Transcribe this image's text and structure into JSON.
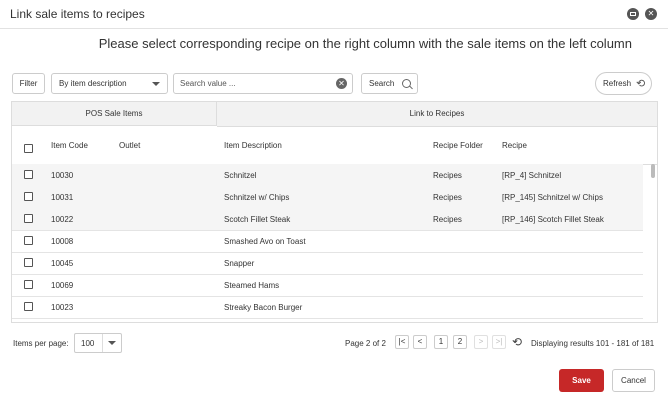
{
  "dialog": {
    "title": "Link sale items to recipes",
    "instructions": "Please select corresponding recipe on the right column with the sale items on the left column"
  },
  "toolbar": {
    "filter_label": "Filter",
    "filter_by": "By item description",
    "search_placeholder": "Search value ...",
    "search_label": "Search",
    "refresh_label": "Refresh"
  },
  "grid": {
    "group_headers": [
      "POS Sale Items",
      "Link to Recipes"
    ],
    "columns": [
      "Item Code",
      "Outlet",
      "Item Description",
      "Recipe Folder",
      "Recipe"
    ],
    "rows": [
      {
        "code": "10030",
        "outlet": "",
        "description": "Schnitzel",
        "folder": "Recipes",
        "recipe": "[RP_4] Schnitzel"
      },
      {
        "code": "10031",
        "outlet": "",
        "description": "Schnitzel w/ Chips",
        "folder": "Recipes",
        "recipe": "[RP_145] Schnitzel w/ Chips"
      },
      {
        "code": "10022",
        "outlet": "",
        "description": "Scotch Fillet Steak",
        "folder": "Recipes",
        "recipe": "[RP_146] Scotch Fillet Steak"
      },
      {
        "code": "10008",
        "outlet": "",
        "description": "Smashed Avo on Toast",
        "folder": "",
        "recipe": ""
      },
      {
        "code": "10045",
        "outlet": "",
        "description": "Snapper",
        "folder": "",
        "recipe": ""
      },
      {
        "code": "10069",
        "outlet": "",
        "description": "Steamed Hams",
        "folder": "",
        "recipe": ""
      },
      {
        "code": "10023",
        "outlet": "",
        "description": "Streaky Bacon Burger",
        "folder": "",
        "recipe": ""
      }
    ]
  },
  "pager": {
    "items_per_page_label": "Items per page:",
    "items_per_page": "100",
    "page_label": "Page 2 of 2",
    "first": "|<",
    "prev": "<",
    "pages": [
      "1",
      "2"
    ],
    "next": ">",
    "last": ">|",
    "display": "Displaying results 101 - 181 of 181"
  },
  "footer": {
    "save_label": "Save",
    "cancel_label": "Cancel"
  },
  "colors": {
    "save": "#c62828",
    "header_bg": "#f2f2f2",
    "alt_row": "#f5f5f5"
  }
}
